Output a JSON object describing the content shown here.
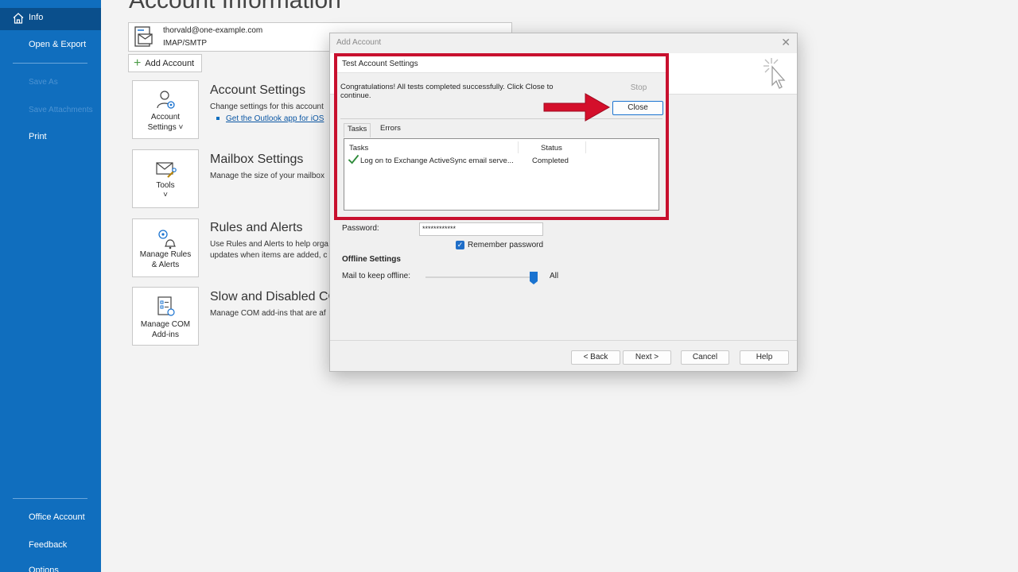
{
  "nav": {
    "info": "Info",
    "open_export": "Open & Export",
    "save_as": "Save As",
    "save_attachments": "Save Attachments",
    "print": "Print",
    "office_account": "Office Account",
    "feedback": "Feedback",
    "options": "Options"
  },
  "main": {
    "title": "Account Information",
    "account_email": "thorvald@one-example.com",
    "account_type": "IMAP/SMTP",
    "add_account": "Add Account",
    "tiles": {
      "account_settings": [
        "Account",
        "Settings ˅"
      ],
      "tools": [
        "Tools",
        "˅"
      ],
      "manage_rules": [
        "Manage Rules",
        "& Alerts"
      ],
      "manage_com": [
        "Manage COM",
        "Add-ins"
      ]
    },
    "sections": {
      "account_settings_title": "Account Settings",
      "account_settings_desc": "Change settings for this account",
      "account_settings_link": "Get the Outlook app for iOS",
      "mailbox_title": "Mailbox Settings",
      "mailbox_desc": "Manage the size of your mailbox",
      "rules_title": "Rules and Alerts",
      "rules_desc_1": "Use Rules and Alerts to help orga",
      "rules_desc_2": "updates when items are added, c",
      "com_title": "Slow and Disabled CO",
      "com_desc": "Manage COM add-ins that are af"
    }
  },
  "dialog": {
    "title": "Add Account",
    "password_label": "Password:",
    "password_value": "************",
    "remember_password": "Remember password",
    "offline_heading": "Offline Settings",
    "mail_offline_label": "Mail to keep offline:",
    "mail_offline_value": "All",
    "mail_offline_level": 1.0,
    "buttons": {
      "back": "< Back",
      "next": "Next >",
      "cancel": "Cancel",
      "help": "Help"
    }
  },
  "test_settings": {
    "title": "Test Account Settings",
    "message": "Congratulations! All tests completed successfully. Click Close to continue.",
    "stop": "Stop",
    "close": "Close",
    "tabs": [
      "Tasks",
      "Errors"
    ],
    "columns": [
      "Tasks",
      "Status"
    ],
    "rows": [
      {
        "task": "Log on to Exchange ActiveSync email serve...",
        "status": "Completed"
      }
    ]
  },
  "colors": {
    "nav_bg": "#106ebe",
    "highlight": "#c8102e",
    "accent": "#1a73d0"
  }
}
